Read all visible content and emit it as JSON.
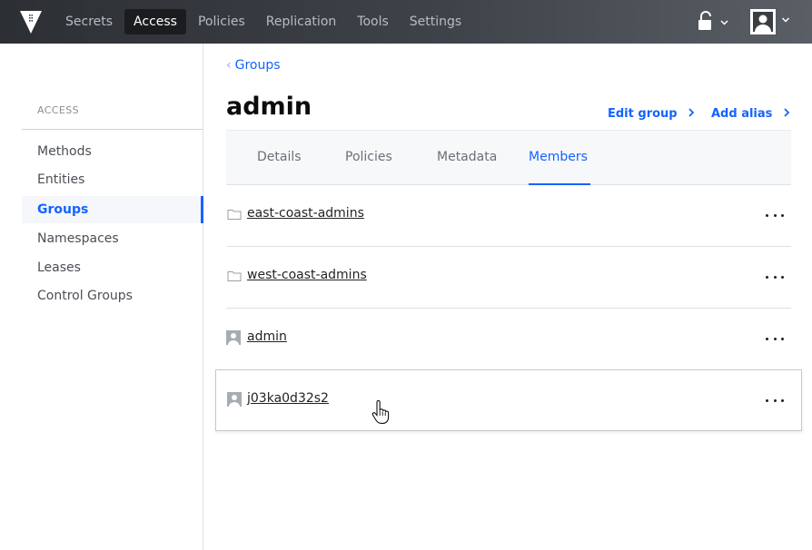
{
  "topnav": {
    "logo": "vault-logo-icon",
    "items": [
      {
        "label": "Secrets",
        "active": false
      },
      {
        "label": "Access",
        "active": true
      },
      {
        "label": "Policies",
        "active": false
      },
      {
        "label": "Replication",
        "active": false
      },
      {
        "label": "Tools",
        "active": false
      },
      {
        "label": "Settings",
        "active": false
      }
    ],
    "status_icon": "unlocked-icon",
    "user_icon": "user-icon"
  },
  "sidebar": {
    "heading": "ACCESS",
    "items": [
      {
        "label": "Methods",
        "active": false
      },
      {
        "label": "Entities",
        "active": false
      },
      {
        "label": "Groups",
        "active": true
      },
      {
        "label": "Namespaces",
        "active": false
      },
      {
        "label": "Leases",
        "active": false
      },
      {
        "label": "Control Groups",
        "active": false
      }
    ]
  },
  "main": {
    "breadcrumb": "Groups",
    "title": "admin",
    "actions": {
      "edit_group": "Edit group",
      "add_alias": "Add alias"
    },
    "tabs": [
      {
        "label": "Details",
        "active": false
      },
      {
        "label": "Policies",
        "active": false
      },
      {
        "label": "Metadata",
        "active": false
      },
      {
        "label": "Members",
        "active": true
      }
    ],
    "members": [
      {
        "name": "east-coast-admins",
        "icon": "folder-icon"
      },
      {
        "name": "west-coast-admins",
        "icon": "folder-icon"
      },
      {
        "name": "admin",
        "icon": "user-icon"
      },
      {
        "name": "j03ka0d32s2",
        "icon": "user-icon"
      }
    ]
  },
  "colors": {
    "accent": "#1563ff",
    "topbar": "#2c2f33"
  }
}
